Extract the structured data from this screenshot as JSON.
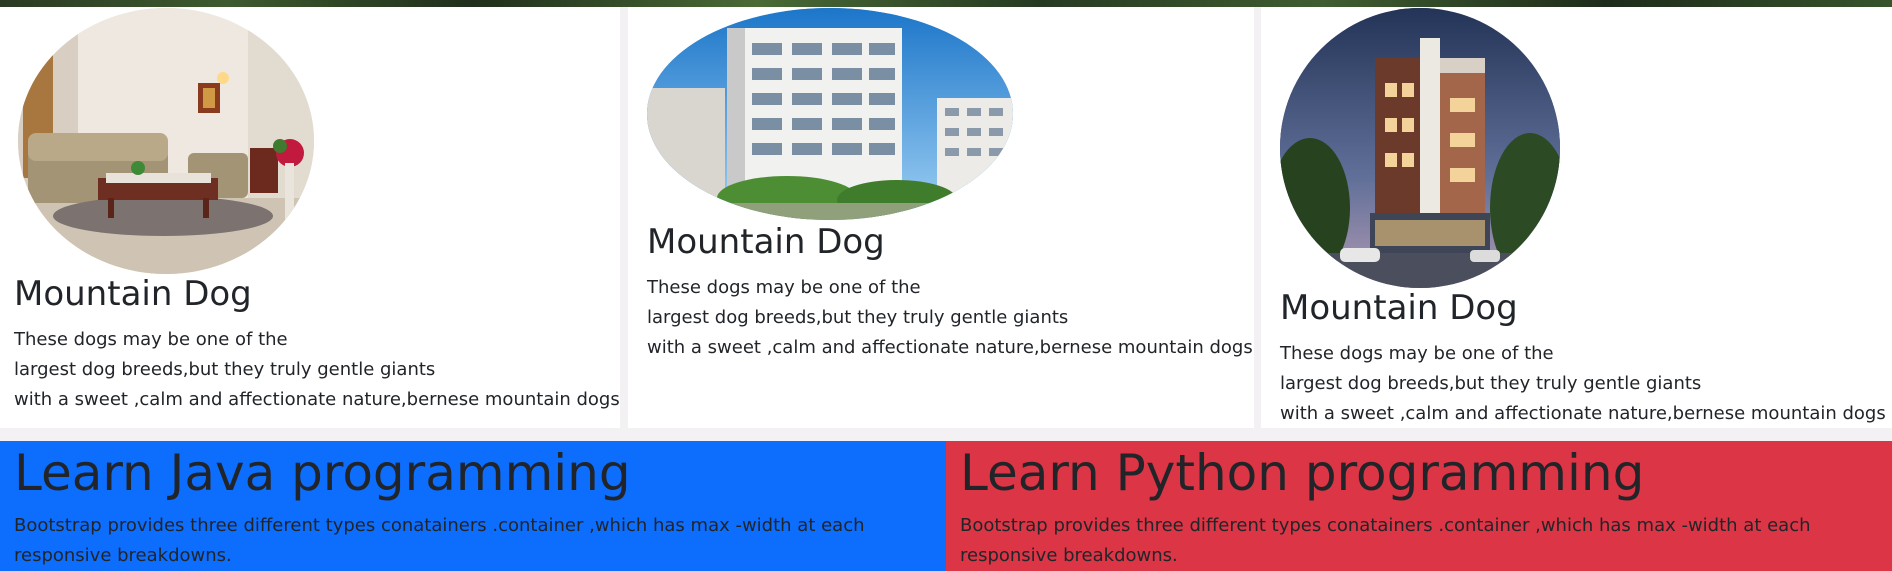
{
  "cards": [
    {
      "title": "Mountain Dog",
      "text_lines": [
        "These dogs may be one of the",
        "largest dog breeds,but they truly gentle giants",
        "with a sweet ,calm and affectionate nature,bernese mountain dogs"
      ]
    },
    {
      "title": "Mountain Dog",
      "text_lines": [
        "These dogs may be one of the",
        "largest dog breeds,but they truly gentle giants",
        "with a sweet ,calm and affectionate nature,bernese mountain dogs"
      ]
    },
    {
      "title": "Mountain Dog",
      "text_lines": [
        "These dogs may be one of the",
        "largest dog breeds,but they truly gentle giants",
        "with a sweet ,calm and affectionate nature,bernese mountain dogs"
      ]
    }
  ],
  "banners": [
    {
      "title": "Learn Java programming",
      "text": "Bootstrap provides three different types conatainers .container ,which has max -width at each responsive breakdowns.",
      "color": "#0d6efd"
    },
    {
      "title": "Learn Python programming",
      "text": "Bootstrap provides three different types conatainers .container ,which has max -width at each responsive breakdowns.",
      "color": "#dc3545"
    }
  ]
}
